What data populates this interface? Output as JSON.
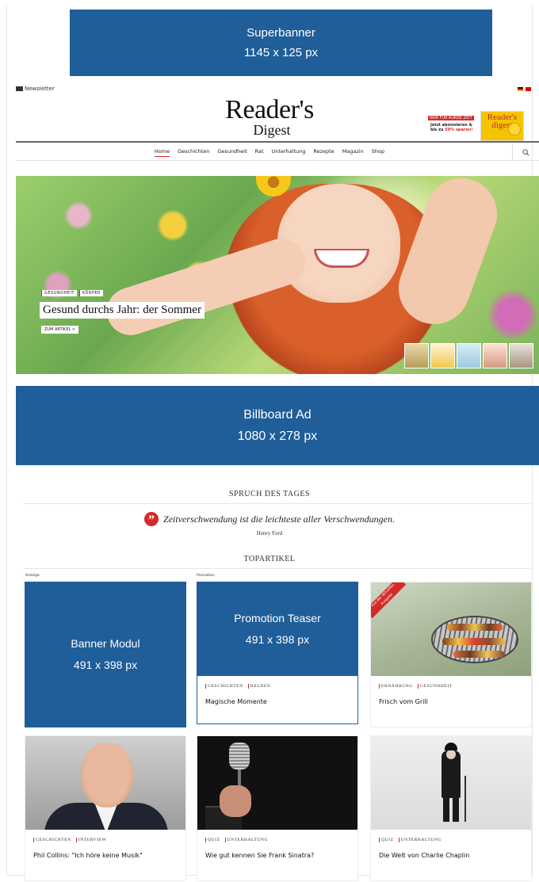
{
  "ads": {
    "superbanner": {
      "name": "Superbanner",
      "size": "1145 x 125 px"
    },
    "billboard": {
      "name": "Billboard Ad",
      "size": "1080 x 278 px"
    },
    "banner_modul": {
      "name": "Banner Modul",
      "size": "491 x 398 px"
    },
    "promotion_teaser": {
      "name": "Promotion Teaser",
      "size": "491 x 398 px"
    }
  },
  "header": {
    "newsletter_label": "Newsletter",
    "logo_line1": "Reader's",
    "logo_line2": "Digest",
    "promo": {
      "badge": "NUR FÜR KURZE ZEIT",
      "line1": "Jetzt abonnieren &",
      "line2_prefix": "bis zu ",
      "line2_highlight": "50% sparen!"
    },
    "magazine_title": "Reader's digest"
  },
  "nav": {
    "items": [
      "Home",
      "Geschichten",
      "Gesundheit",
      "Rat",
      "Unterhaltung",
      "Rezepte",
      "Magazin",
      "Shop"
    ],
    "active": "Home"
  },
  "hero": {
    "tags": [
      "GESUNDHEIT",
      "KÖRPER"
    ],
    "title": "Gesund durchs Jahr: der Sommer",
    "cta": "ZUM ARTIKEL  >"
  },
  "quote_section": {
    "heading": "SPRUCH DES TAGES",
    "quote": "Zeitverschwendung ist die leichteste aller Verschwendungen.",
    "author": "Henry Ford"
  },
  "top_articles": {
    "heading": "TOPARTIKEL",
    "anzeige_label": "Anzeige",
    "promotion_label": "Promotion",
    "promo_card": {
      "tags": [
        "GESCHICHTEN",
        "HELDEN"
      ],
      "title": "Magische Momente"
    },
    "cards": [
      {
        "tags": [
          "ERNÄHRUNG",
          "GESUNDHEIT"
        ],
        "title": "Frisch vom Grill",
        "ribbon": "Aus der aktuellen Ausgabe"
      },
      {
        "tags": [
          "GESCHICHTEN",
          "INTERVIEW"
        ],
        "title": "Phil Collins: \"Ich höre keine Musik\""
      },
      {
        "tags": [
          "QUIZ",
          "UNTERHALTUNG"
        ],
        "title": "Wie gut kennen Sie Frank Sinatra?"
      },
      {
        "tags": [
          "QUIZ",
          "UNTERHALTUNG"
        ],
        "title": "Die Welt von Charlie Chaplin"
      }
    ]
  },
  "colors": {
    "ad_blue": "#1f5e99",
    "accent_red": "#d42a2a"
  }
}
